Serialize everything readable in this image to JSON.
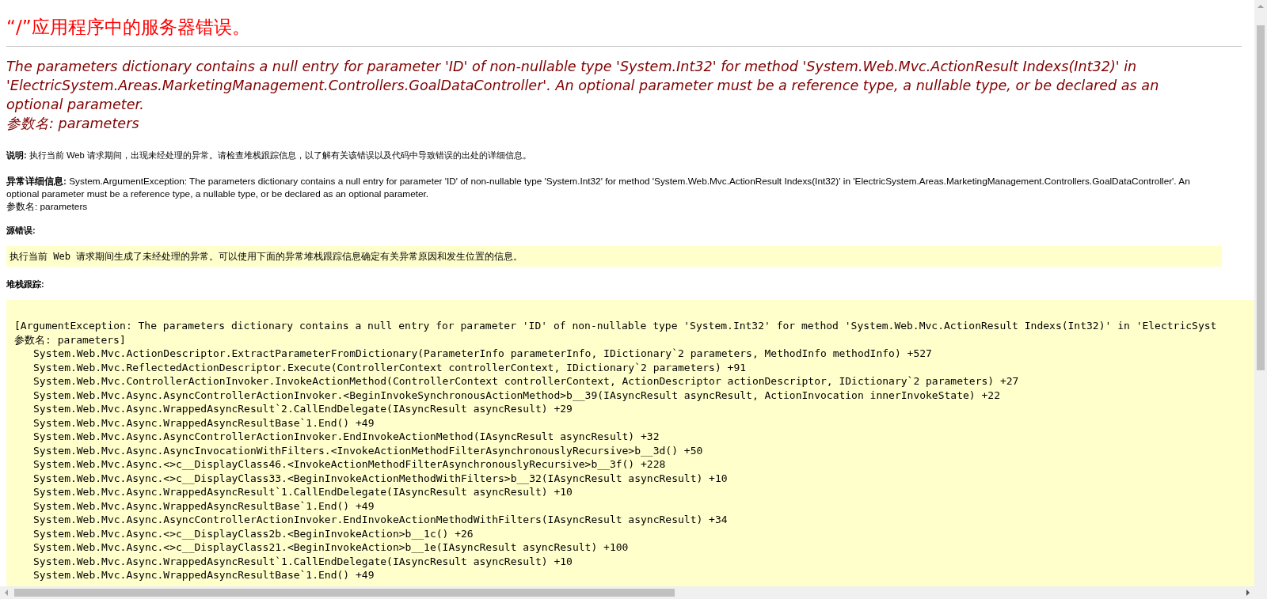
{
  "title": "“/”应用程序中的服务器错误。",
  "error_message": {
    "lines": [
      "The parameters dictionary contains a null entry for parameter 'ID' of non-nullable type 'System.Int32' for method 'System.Web.Mvc.ActionResult Indexs(Int32)' in 'ElectricSystem.Areas.MarketingManagement.Controllers.GoalDataController'. An optional parameter must be a reference type, a nullable type, or be declared as an optional parameter.",
      "参数名: parameters"
    ]
  },
  "description": "**说明:** 执行当前 Web 请求期间，出现未经处理的异常。请检查堆栈跟踪信息，以了解有关该错误以及代码中导致错误的出处的详细信息。",
  "exception_details": {
    "text": "**异常详细信息:** System.ArgumentException: The parameters dictionary contains a null entry for parameter 'ID' of non-nullable type 'System.Int32' for method 'System.Web.Mvc.ActionResult Indexs(Int32)' in 'ElectricSystem.Areas.MarketingManagement.Controllers.GoalDataController'. An optional parameter must be a reference type, a nullable type, or be declared as an optional parameter.",
    "param_line": "参数名: parameters"
  },
  "source_error": {
    "label": "源错误:",
    "message": "执行当前 Web 请求期间生成了未经处理的异常。可以使用下面的异常堆栈跟踪信息确定有关异常原因和发生位置的信息。"
  },
  "stack_trace": {
    "label": "堆栈跟踪:",
    "header": [
      "[ArgumentException: The parameters dictionary contains a null entry for parameter 'ID' of non-nullable type 'System.Int32' for method 'System.Web.Mvc.ActionResult Indexs(Int32)' in 'ElectricSyst",
      "参数名: parameters]"
    ],
    "frames": [
      "System.Web.Mvc.ActionDescriptor.ExtractParameterFromDictionary(ParameterInfo parameterInfo, IDictionary`2 parameters, MethodInfo methodInfo) +527",
      "System.Web.Mvc.ReflectedActionDescriptor.Execute(ControllerContext controllerContext, IDictionary`2 parameters) +91",
      "System.Web.Mvc.ControllerActionInvoker.InvokeActionMethod(ControllerContext controllerContext, ActionDescriptor actionDescriptor, IDictionary`2 parameters) +27",
      "System.Web.Mvc.Async.AsyncControllerActionInvoker.<BeginInvokeSynchronousActionMethod>b__39(IAsyncResult asyncResult, ActionInvocation innerInvokeState) +22",
      "System.Web.Mvc.Async.WrappedAsyncResult`2.CallEndDelegate(IAsyncResult asyncResult) +29",
      "System.Web.Mvc.Async.WrappedAsyncResultBase`1.End() +49",
      "System.Web.Mvc.Async.AsyncControllerActionInvoker.EndInvokeActionMethod(IAsyncResult asyncResult) +32",
      "System.Web.Mvc.Async.AsyncInvocationWithFilters.<InvokeActionMethodFilterAsynchronouslyRecursive>b__3d() +50",
      "System.Web.Mvc.Async.<>c__DisplayClass46.<InvokeActionMethodFilterAsynchronouslyRecursive>b__3f() +228",
      "System.Web.Mvc.Async.<>c__DisplayClass33.<BeginInvokeActionMethodWithFilters>b__32(IAsyncResult asyncResult) +10",
      "System.Web.Mvc.Async.WrappedAsyncResult`1.CallEndDelegate(IAsyncResult asyncResult) +10",
      "System.Web.Mvc.Async.WrappedAsyncResultBase`1.End() +49",
      "System.Web.Mvc.Async.AsyncControllerActionInvoker.EndInvokeActionMethodWithFilters(IAsyncResult asyncResult) +34",
      "System.Web.Mvc.Async.<>c__DisplayClass2b.<BeginInvokeAction>b__1c() +26",
      "System.Web.Mvc.Async.<>c__DisplayClass21.<BeginInvokeAction>b__1e(IAsyncResult asyncResult) +100",
      "System.Web.Mvc.Async.WrappedAsyncResult`1.CallEndDelegate(IAsyncResult asyncResult) +10",
      "System.Web.Mvc.Async.WrappedAsyncResultBase`1.End() +49"
    ]
  }
}
